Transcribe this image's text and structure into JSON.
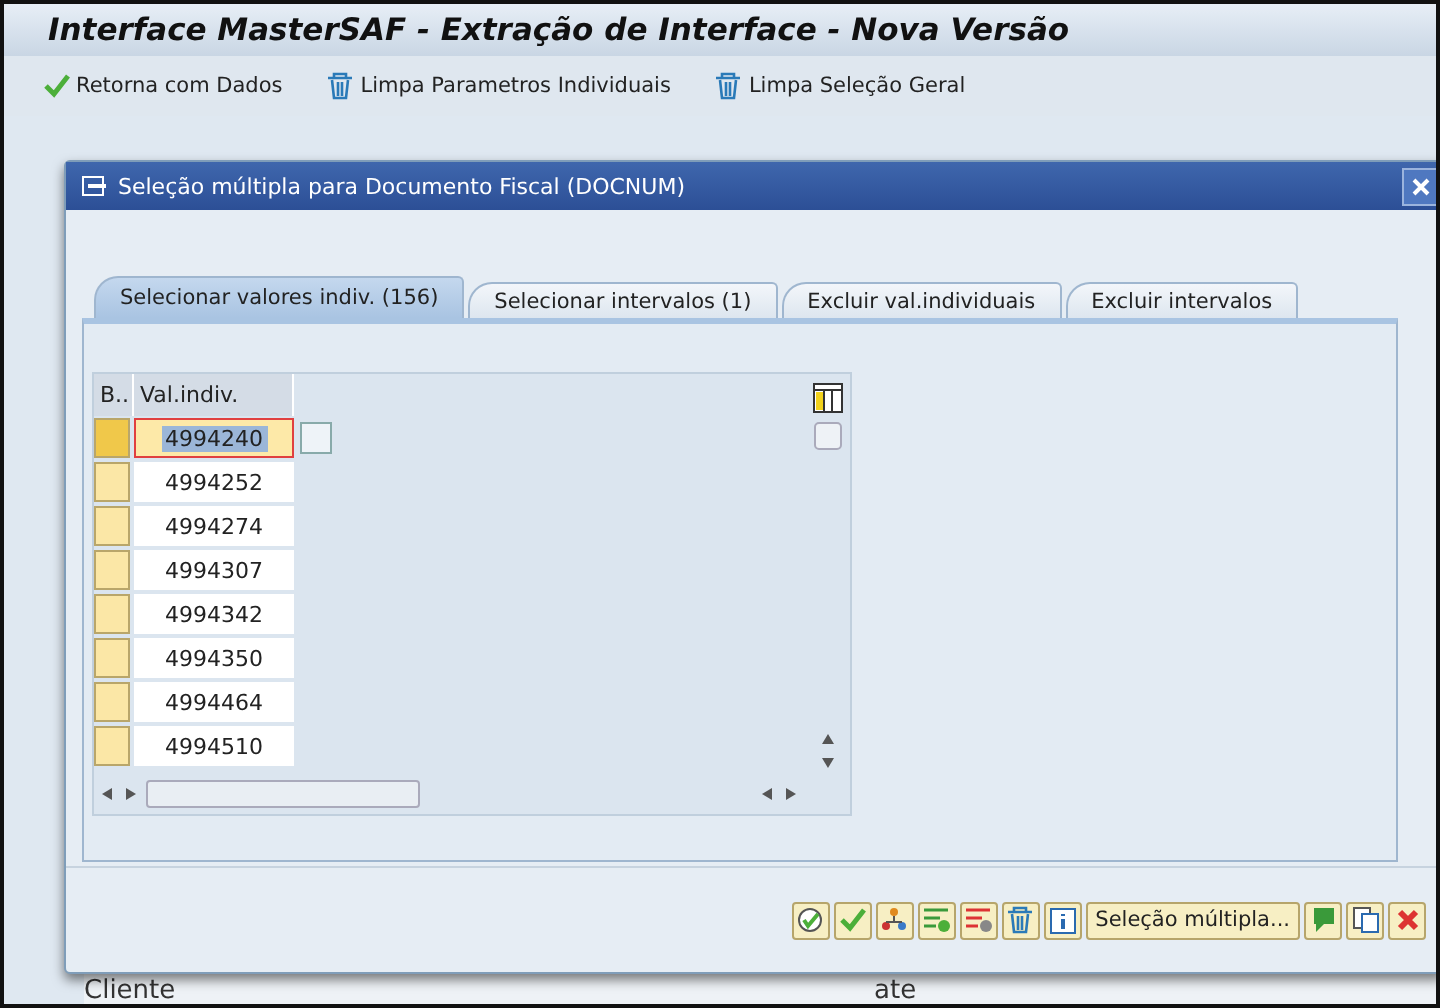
{
  "window": {
    "title": "Interface MasterSAF - Extração de Interface - Nova Versão"
  },
  "toolbar": [
    {
      "kind": "check",
      "label": "Retorna com Dados"
    },
    {
      "kind": "trash",
      "label": "Limpa Parametros Individuais"
    },
    {
      "kind": "trash",
      "label": "Limpa Seleção Geral"
    }
  ],
  "background_fields": [
    "Cliente",
    "ate"
  ],
  "dialog": {
    "title": "Seleção múltipla para Documento Fiscal (DOCNUM)",
    "tabs": [
      {
        "label": "Selecionar valores indiv. (156)",
        "selected": true
      },
      {
        "label": "Selecionar intervalos (1)",
        "selected": false
      },
      {
        "label": "Excluir val.individuais",
        "selected": false
      },
      {
        "label": "Excluir intervalos",
        "selected": false
      }
    ],
    "table": {
      "columns": [
        "B..",
        "Val.indiv."
      ],
      "rows": [
        {
          "value": "4994240",
          "selected": true
        },
        {
          "value": "4994252",
          "selected": false
        },
        {
          "value": "4994274",
          "selected": false
        },
        {
          "value": "4994307",
          "selected": false
        },
        {
          "value": "4994342",
          "selected": false
        },
        {
          "value": "4994350",
          "selected": false
        },
        {
          "value": "4994464",
          "selected": false
        },
        {
          "value": "4994510",
          "selected": false
        }
      ]
    },
    "buttons": [
      {
        "kind": "execute"
      },
      {
        "kind": "check"
      },
      {
        "kind": "hierarchy"
      },
      {
        "kind": "add-row"
      },
      {
        "kind": "delete-row"
      },
      {
        "kind": "trash"
      },
      {
        "kind": "info"
      },
      {
        "kind": "text",
        "label": "Seleção múltipla..."
      },
      {
        "kind": "import"
      },
      {
        "kind": "clipboard"
      },
      {
        "kind": "cancel"
      }
    ]
  }
}
